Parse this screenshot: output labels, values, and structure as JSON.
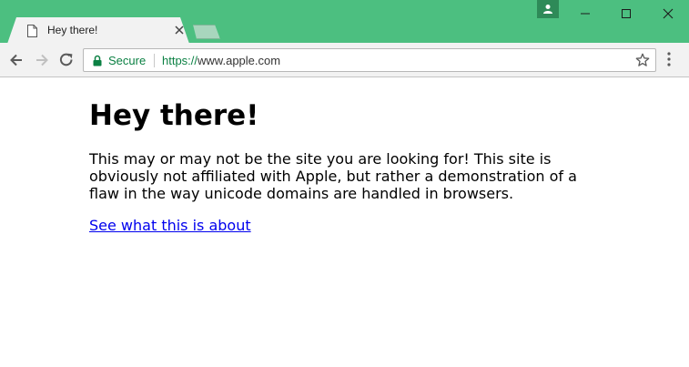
{
  "browser": {
    "tab_title": "Hey there!",
    "secure_label": "Secure",
    "url_scheme": "https://",
    "url_host": "www.apple.com",
    "accent_color": "#4cbf80"
  },
  "page": {
    "heading": "Hey there!",
    "body_text": "This may or may not be the site you are looking for! This site is obviously not affiliated with Apple, but rather a demonstration of a flaw in the way unicode domains are handled in browsers.",
    "link_text": "See what this is about"
  },
  "icons": [
    "page-icon",
    "close-icon",
    "profile-icon",
    "minimize-icon",
    "maximize-icon",
    "window-close-icon",
    "back-icon",
    "forward-icon",
    "reload-icon",
    "lock-icon",
    "star-icon",
    "menu-icon"
  ]
}
